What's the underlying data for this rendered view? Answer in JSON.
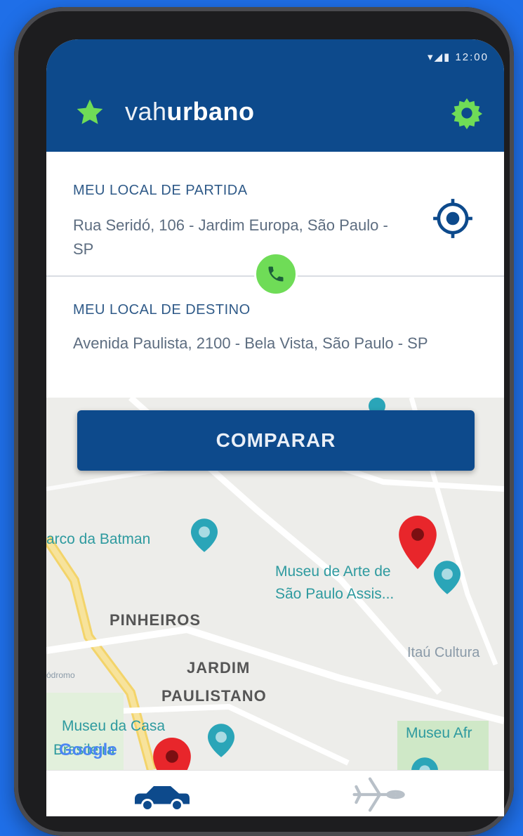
{
  "status_bar": {
    "icons": "▾◢▮ 12:00"
  },
  "header": {
    "brand_light": "vah",
    "brand_bold": "urbano",
    "colors": {
      "bar": "#0d4a8c",
      "accent": "#6fdc57"
    },
    "logo_icon": "star-icon",
    "settings_icon": "gear-icon"
  },
  "origin": {
    "label": "MEU LOCAL DE PARTIDA",
    "address": "Rua Seridó, 106 - Jardim Europa, São Paulo - SP",
    "locate_icon": "gps-target-icon"
  },
  "swap_icon": "phone-icon",
  "destination": {
    "label": "MEU LOCAL DE DESTINO",
    "address": "Avenida Paulista, 2100 - Bela Vista, São Paulo - SP"
  },
  "compare_label": "COMPARAR",
  "map": {
    "labels": {
      "parque": "arco da Batman",
      "museu_arte": "Museu de Arte de",
      "museu_arte_2": "São Paulo Assis...",
      "pinheiros": "PINHEIROS",
      "jardim": "JARDIM",
      "paulistano": "PAULISTANO",
      "itau": "Itaú Cultura",
      "museu_casa": "Museu da Casa",
      "brasileira": "Brasileira",
      "museu_afro": "Museu Afr",
      "side": "Hipódromo"
    },
    "google": "Google",
    "colors": {
      "marker": "#e8262b",
      "poi": "#2aa5b8",
      "road": "#f7d774"
    }
  },
  "bottom_nav": {
    "car_icon": "car-icon",
    "plane_icon": "airplane-icon"
  }
}
